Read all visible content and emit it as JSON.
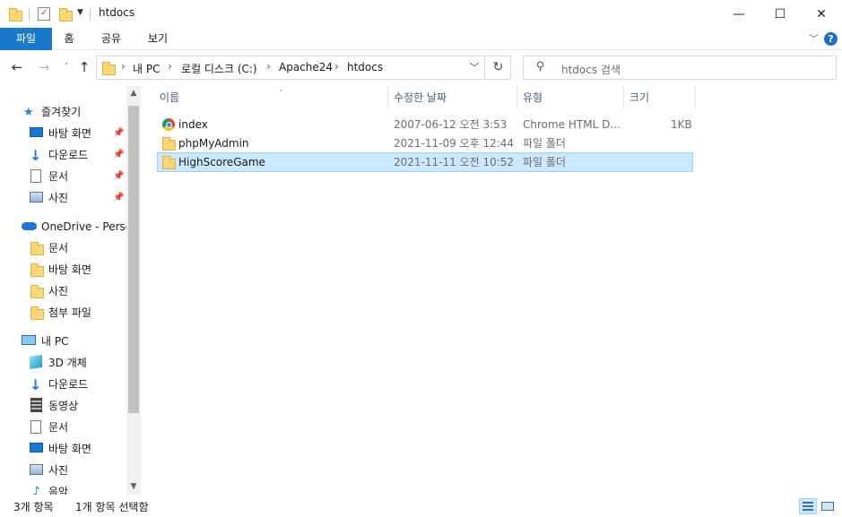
{
  "window": {
    "title": "htdocs",
    "controls": {
      "minimize": "—",
      "maximize": "☐",
      "close": "✕"
    }
  },
  "ribbon": {
    "tabs": [
      "파일",
      "홈",
      "공유",
      "보기"
    ],
    "help": "?"
  },
  "address": {
    "crumbs": [
      "내 PC",
      "로컬 디스크 (C:)",
      "Apache24",
      "htdocs"
    ],
    "search_placeholder": "htdocs 검색"
  },
  "nav": {
    "quick_access": {
      "label": "즐겨찾기",
      "items": [
        "바탕 화면",
        "다운로드",
        "문서",
        "사진"
      ]
    },
    "onedrive": {
      "label": "OneDrive - Personal",
      "items": [
        "문서",
        "바탕 화면",
        "사진",
        "첨부 파일"
      ]
    },
    "this_pc": {
      "label": "내 PC",
      "items": [
        "3D 개체",
        "다운로드",
        "동영상",
        "문서",
        "바탕 화면",
        "사진",
        "음악"
      ]
    }
  },
  "columns": [
    "이름",
    "수정한 날짜",
    "유형",
    "크기"
  ],
  "files": [
    {
      "name": "index",
      "modified": "2007-06-12 오전 3:53",
      "type": "Chrome HTML D...",
      "size": "1KB",
      "icon": "chrome-icon",
      "selected": false
    },
    {
      "name": "phpMyAdmin",
      "modified": "2021-11-09 오후 12:44",
      "type": "파일 폴더",
      "size": "",
      "icon": "folder-icon",
      "selected": false
    },
    {
      "name": "HighScoreGame",
      "modified": "2021-11-11 오전 10:52",
      "type": "파일 폴더",
      "size": "",
      "icon": "folder-icon",
      "selected": true
    }
  ],
  "status": {
    "count": "3개 항목",
    "selection": "1개 항목 선택함"
  },
  "colors": {
    "accent": "#1979ca",
    "selection_bg": "#cce8ff",
    "selection_border": "#99d1ff",
    "folder": "#f8d775"
  }
}
